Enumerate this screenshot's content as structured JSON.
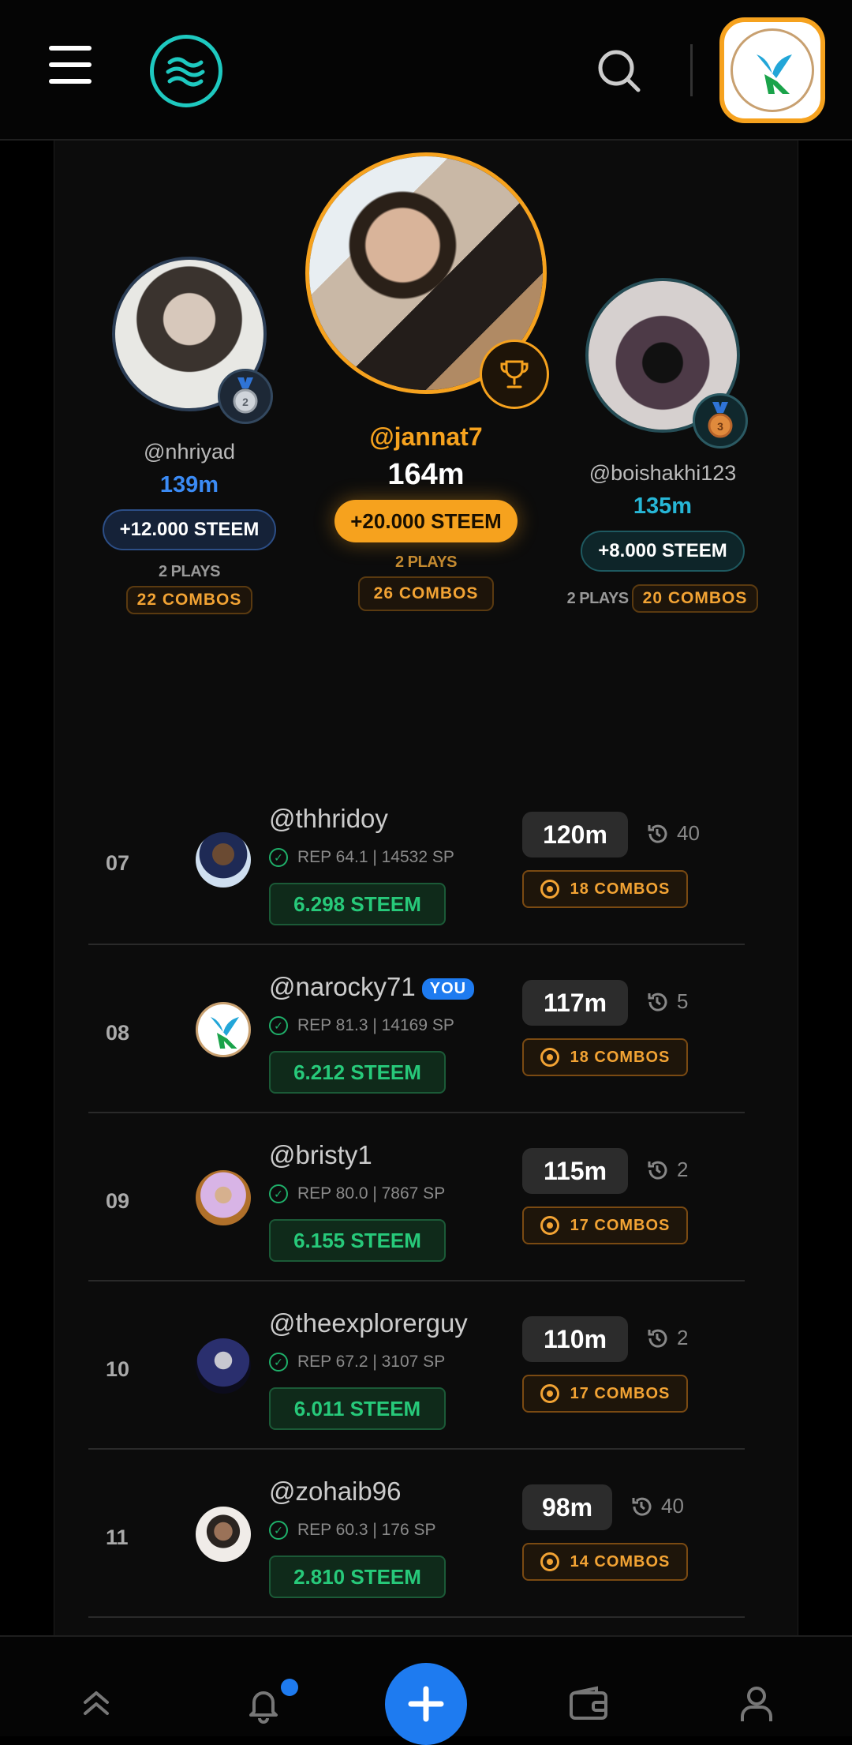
{
  "podium": {
    "second": {
      "username": "@nhriyad",
      "score": "139m",
      "reward": "+12.000 STEEM",
      "plays": "2 PLAYS",
      "combos": "22 COMBOS"
    },
    "first": {
      "username": "@jannat7",
      "score": "164m",
      "reward": "+20.000 STEEM",
      "plays": "2 PLAYS",
      "combos": "26 COMBOS"
    },
    "third": {
      "username": "@boishakhi123",
      "score": "135m",
      "reward": "+8.000 STEEM",
      "plays": "2 PLAYS",
      "combos": "20 COMBOS"
    }
  },
  "rows": [
    {
      "rank": "07",
      "username": "@thhridoy",
      "rep": "REP 64.1 | 14532 SP",
      "steem": "6.298 STEEM",
      "score": "120m",
      "plays": "40",
      "combos": "18 COMBOS"
    },
    {
      "rank": "08",
      "username": "@narocky71",
      "you": "YOU",
      "rep": "REP 81.3 | 14169 SP",
      "steem": "6.212 STEEM",
      "score": "117m",
      "plays": "5",
      "combos": "18 COMBOS"
    },
    {
      "rank": "09",
      "username": "@bristy1",
      "rep": "REP 80.0 | 7867 SP",
      "steem": "6.155 STEEM",
      "score": "115m",
      "plays": "2",
      "combos": "17 COMBOS"
    },
    {
      "rank": "10",
      "username": "@theexplorerguy",
      "rep": "REP 67.2 | 3107 SP",
      "steem": "6.011 STEEM",
      "score": "110m",
      "plays": "2",
      "combos": "17 COMBOS"
    },
    {
      "rank": "11",
      "username": "@zohaib96",
      "rep": "REP 60.3 | 176 SP",
      "steem": "2.810 STEEM",
      "score": "98m",
      "plays": "40",
      "combos": "14 COMBOS"
    }
  ],
  "colors": {
    "accent": "#1e7bf0",
    "gold": "#f6a21e",
    "steem_green": "#27c97a",
    "combo_orange": "#f2a334",
    "teal": "#1ec9c0"
  }
}
